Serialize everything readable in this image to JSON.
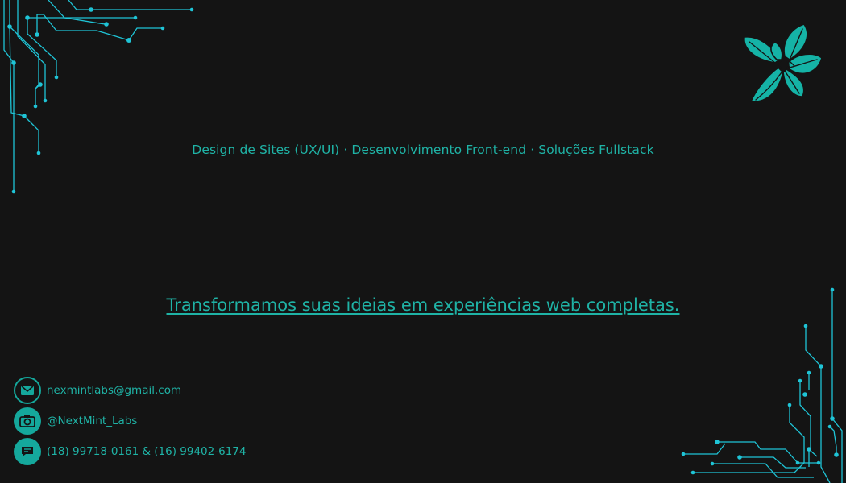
{
  "colors": {
    "background": "#141414",
    "accent": "#1fb3a6",
    "circuit": "#1fc4d6",
    "logo": "#15b3a6"
  },
  "logo": {
    "icon": "mint-leaf-icon"
  },
  "services": {
    "text": "Design de Sites (UX/UI) · Desenvolvimento Front-end · Soluções Fullstack"
  },
  "headline": {
    "text": "Transformamos suas ideias em experiências web completas."
  },
  "contacts": {
    "email": {
      "icon": "mail-icon",
      "text": "nexmintlabs@gmail.com"
    },
    "instagram": {
      "icon": "camera-icon",
      "text": "@NextMint_Labs"
    },
    "phone": {
      "icon": "chat-icon",
      "text": "(18) 99718-0161 &  (16) 99402-6174"
    }
  }
}
